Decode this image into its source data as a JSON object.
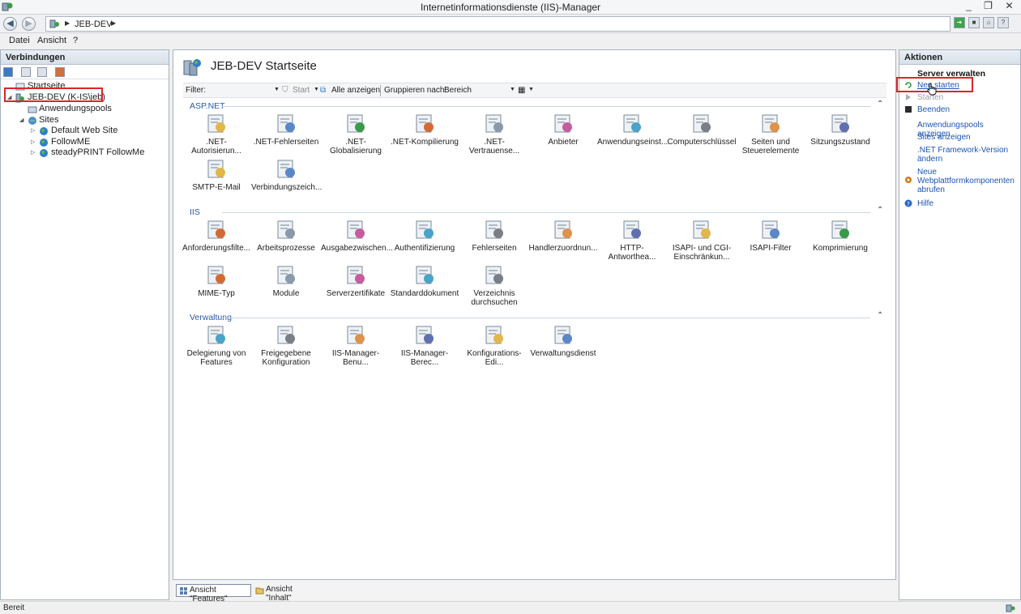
{
  "window": {
    "title": "Internetinformationsdienste (IIS)-Manager",
    "minimize": "_",
    "maximize": "❐",
    "close": "✕"
  },
  "address": {
    "crumb": "JEB-DEV"
  },
  "menu": {
    "file": "Datei",
    "view": "Ansicht",
    "help": "?"
  },
  "connections": {
    "title": "Verbindungen",
    "tree": [
      {
        "label": "Startseite",
        "icon": "start-page-icon"
      },
      {
        "label": "JEB-DEV (K-IS\\jeb)",
        "icon": "server-icon"
      },
      {
        "label": "Anwendungspools",
        "icon": "app-pools-icon"
      },
      {
        "label": "Sites",
        "icon": "sites-folder-icon"
      },
      {
        "label": "Default Web Site",
        "icon": "globe-icon"
      },
      {
        "label": "FollowME",
        "icon": "globe-icon"
      },
      {
        "label": "steadyPRINT FollowMe",
        "icon": "globe-icon"
      }
    ]
  },
  "center": {
    "title": "JEB-DEV Startseite",
    "filter": {
      "label": "Filter:",
      "start": "Start",
      "show_all": "Alle anzeigen",
      "group_by": "Gruppieren nach:",
      "group_value": "Bereich"
    },
    "groups": [
      {
        "name": "ASP.NET",
        "features": [
          {
            "label": ".NET-Autorisierun...",
            "icon": "net-authorization-icon"
          },
          {
            "label": ".NET-Fehlerseiten",
            "icon": "net-error-pages-icon"
          },
          {
            "label": ".NET-Globalisierung",
            "icon": "net-globalization-icon"
          },
          {
            "label": ".NET-Kompilierung",
            "icon": "net-compilation-icon"
          },
          {
            "label": ".NET-Vertrauense...",
            "icon": "net-trust-levels-icon"
          },
          {
            "label": "Anbieter",
            "icon": "providers-icon"
          },
          {
            "label": "Anwendungseinst...",
            "icon": "app-settings-icon"
          },
          {
            "label": "Computerschlüssel",
            "icon": "machine-key-icon"
          },
          {
            "label": "Seiten und Steuerelemente",
            "icon": "pages-controls-icon"
          },
          {
            "label": "Sitzungszustand",
            "icon": "session-state-icon"
          },
          {
            "label": "SMTP-E-Mail",
            "icon": "smtp-email-icon"
          },
          {
            "label": "Verbindungszeich...",
            "icon": "connection-strings-icon"
          }
        ]
      },
      {
        "name": "IIS",
        "features": [
          {
            "label": "Anforderungsfilte...",
            "icon": "request-filtering-icon"
          },
          {
            "label": "Arbeitsprozesse",
            "icon": "worker-processes-icon"
          },
          {
            "label": "Ausgabezwischen...",
            "icon": "output-caching-icon"
          },
          {
            "label": "Authentifizierung",
            "icon": "authentication-icon"
          },
          {
            "label": "Fehlerseiten",
            "icon": "error-pages-icon"
          },
          {
            "label": "Handlerzuordnun...",
            "icon": "handler-mappings-icon"
          },
          {
            "label": "HTTP-Antworthea...",
            "icon": "http-headers-icon"
          },
          {
            "label": "ISAPI- und CGI-Einschränkun...",
            "icon": "isapi-cgi-icon"
          },
          {
            "label": "ISAPI-Filter",
            "icon": "isapi-filter-icon"
          },
          {
            "label": "Komprimierung",
            "icon": "compression-icon"
          },
          {
            "label": "MIME-Typ",
            "icon": "mime-types-icon"
          },
          {
            "label": "Module",
            "icon": "modules-icon"
          },
          {
            "label": "Serverzertifikate",
            "icon": "server-certificates-icon"
          },
          {
            "label": "Standarddokument",
            "icon": "default-document-icon"
          },
          {
            "label": "Verzeichnis durchsuchen",
            "icon": "directory-browsing-icon"
          }
        ]
      },
      {
        "name": "Verwaltung",
        "features": [
          {
            "label": "Delegierung von Features",
            "icon": "feature-delegation-icon"
          },
          {
            "label": "Freigegebene Konfiguration",
            "icon": "shared-config-icon"
          },
          {
            "label": "IIS-Manager-Benu...",
            "icon": "manager-users-icon"
          },
          {
            "label": "IIS-Manager-Berec...",
            "icon": "manager-permissions-icon"
          },
          {
            "label": "Konfigurations-Edi...",
            "icon": "config-editor-icon"
          },
          {
            "label": "Verwaltungsdienst",
            "icon": "management-service-icon"
          }
        ]
      }
    ],
    "view_features": "Ansicht \"Features\"",
    "view_content": "Ansicht \"Inhalt\""
  },
  "actions": {
    "title": "Aktionen",
    "section": "Server verwalten",
    "restart": "Neu starten",
    "start": "Starten",
    "stop": "Beenden",
    "view_app_pools": "Anwendungspools anzeigen",
    "view_sites": "Sites anzeigen",
    "change_net_version": ".NET Framework-Version ändern",
    "get_components": "Neue Webplattformkomponenten abrufen",
    "help": "Hilfe"
  },
  "status": {
    "text": "Bereit"
  },
  "colors": {
    "accent": "#1a55b5",
    "highlight": "#d9262c"
  }
}
